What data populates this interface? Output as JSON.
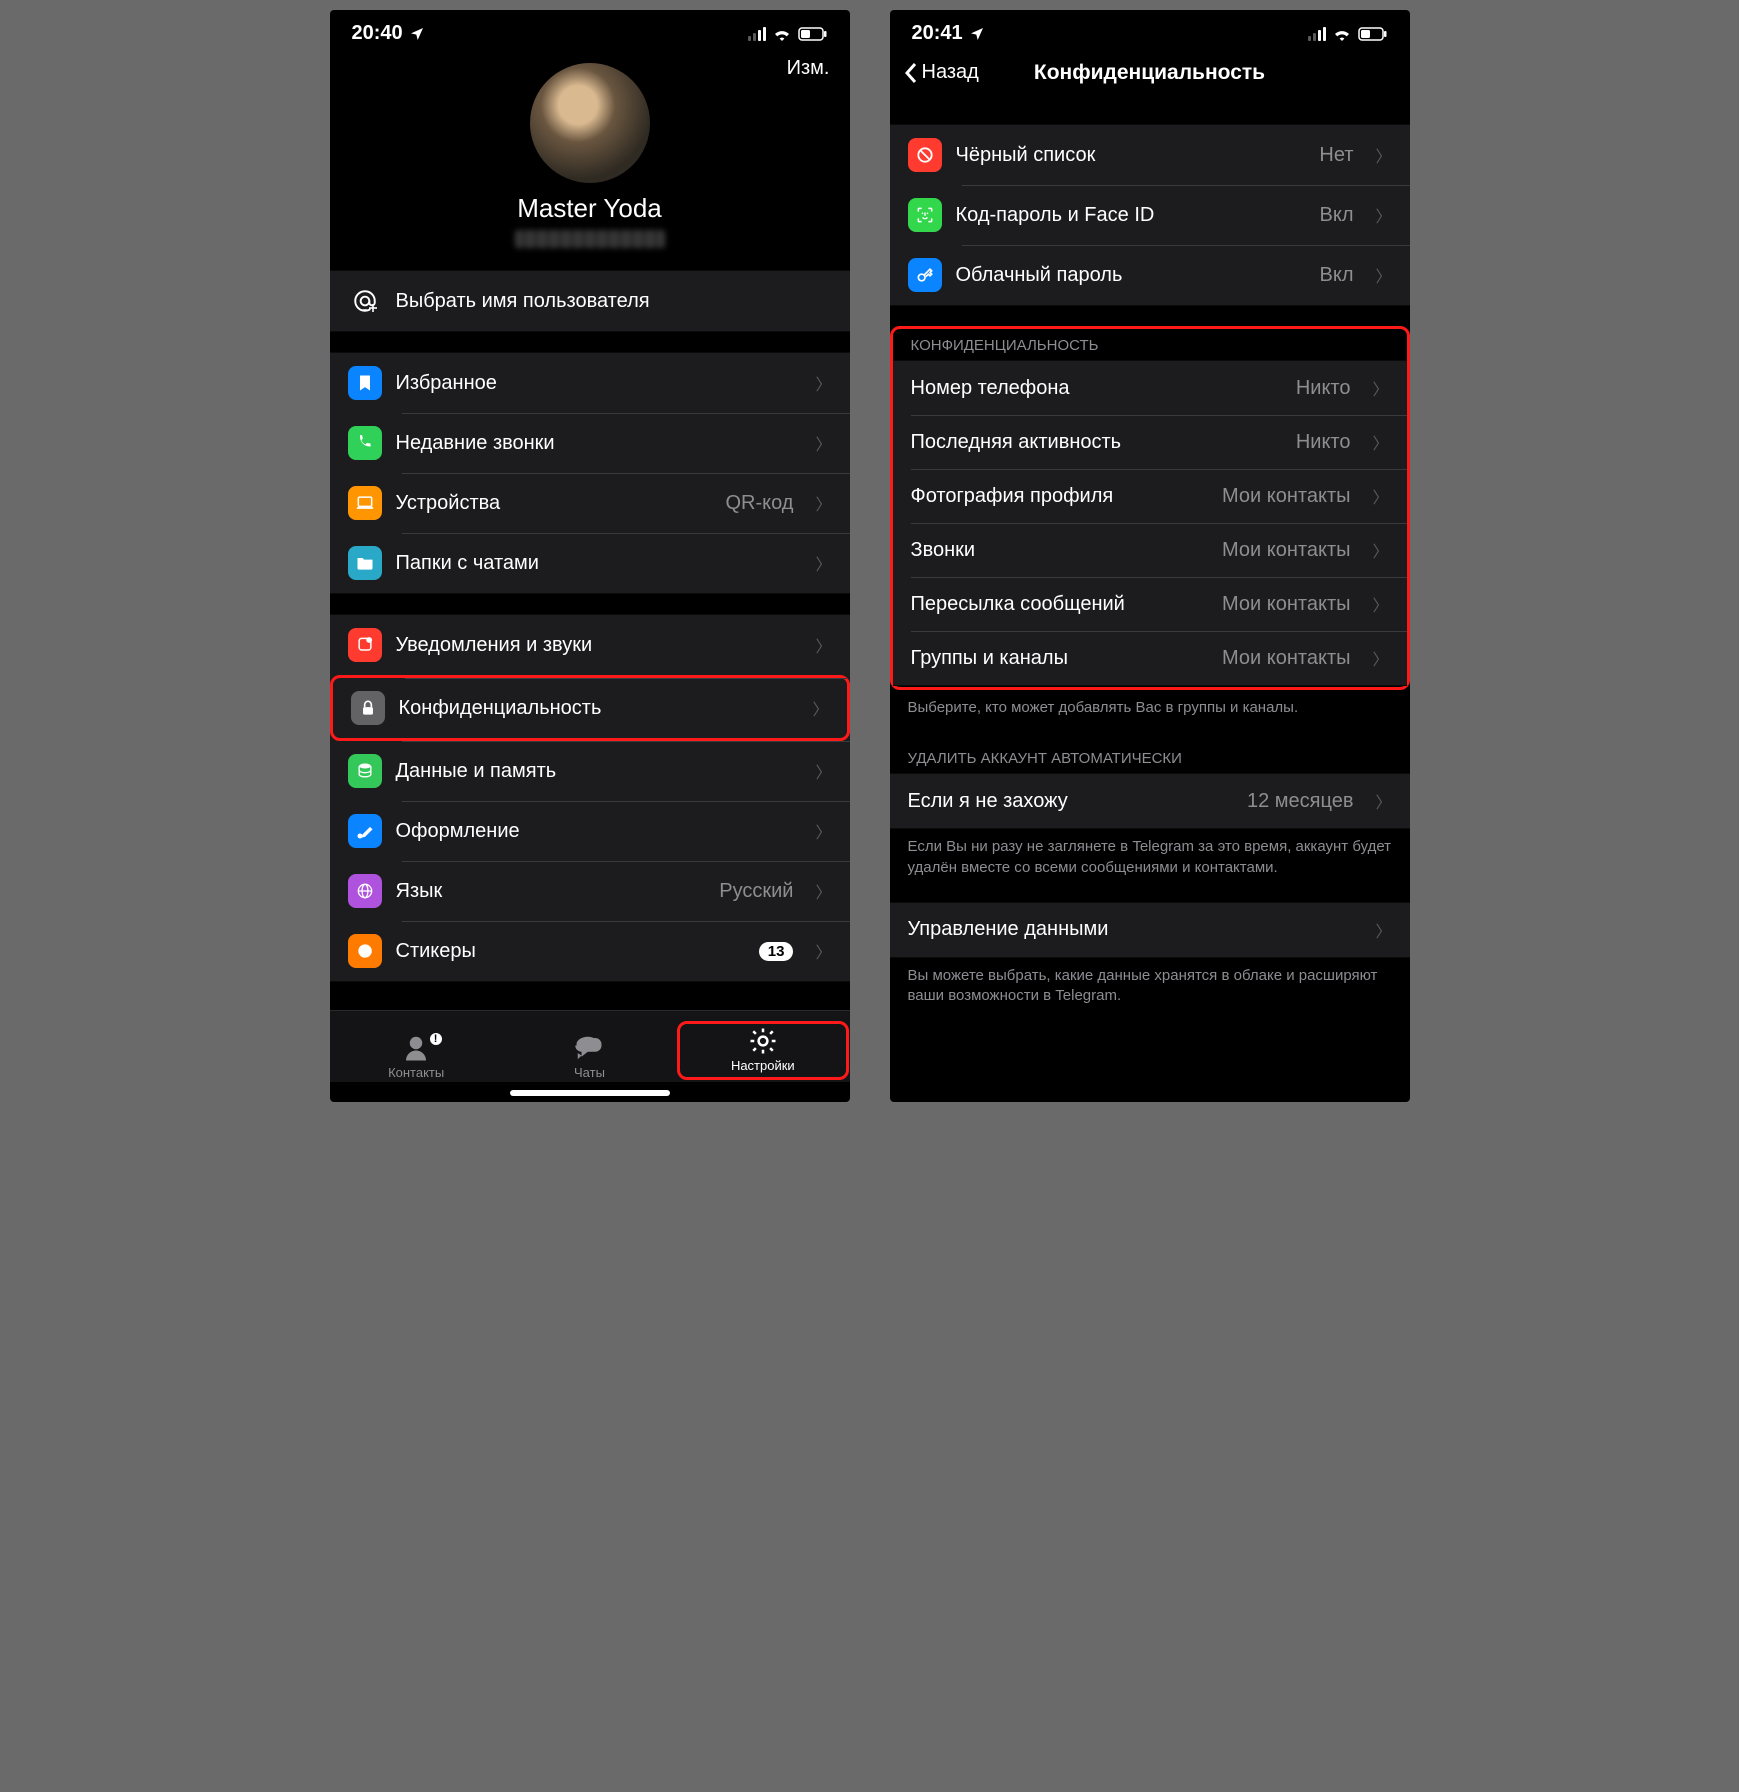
{
  "left": {
    "status_time": "20:40",
    "edit": "Изм.",
    "profile_name": "Master Yoda",
    "username_row": "Выбрать имя пользователя",
    "group1": [
      {
        "id": "favorites",
        "label": "Избранное",
        "value": "",
        "icon": "bookmark",
        "color": "bluebox"
      },
      {
        "id": "recent-calls",
        "label": "Недавние звонки",
        "value": "",
        "icon": "phone",
        "color": "greenbox"
      },
      {
        "id": "devices",
        "label": "Устройства",
        "value": "QR-код",
        "icon": "laptop",
        "color": "orangebox"
      },
      {
        "id": "folders",
        "label": "Папки с чатами",
        "value": "",
        "icon": "folder",
        "color": "tealbox"
      }
    ],
    "group2": [
      {
        "id": "notifications",
        "label": "Уведомления и звуки",
        "value": "",
        "icon": "bell",
        "color": "redbox"
      },
      {
        "id": "privacy",
        "label": "Конфиденциальность",
        "value": "",
        "icon": "lock",
        "color": "graybox",
        "highlight": true
      },
      {
        "id": "data",
        "label": "Данные и память",
        "value": "",
        "icon": "stack",
        "color": "lt-greenbox"
      },
      {
        "id": "appearance",
        "label": "Оформление",
        "value": "",
        "icon": "brush",
        "color": "bluebox"
      },
      {
        "id": "language",
        "label": "Язык",
        "value": "Русский",
        "icon": "globe",
        "color": "purplebox"
      },
      {
        "id": "stickers",
        "label": "Стикеры",
        "value": "",
        "badge": "13",
        "icon": "pacman",
        "color": "dkorange"
      }
    ],
    "tabs": {
      "contacts": "Контакты",
      "chats": "Чаты",
      "settings": "Настройки"
    }
  },
  "right": {
    "status_time": "20:41",
    "back": "Назад",
    "title": "Конфиденциальность",
    "sec_group": [
      {
        "id": "blacklist",
        "label": "Чёрный список",
        "value": "Нет",
        "icon": "slash",
        "color": "redbox"
      },
      {
        "id": "passcode",
        "label": "Код-пароль и Face ID",
        "value": "Вкл",
        "icon": "faceid",
        "color": "facebox"
      },
      {
        "id": "cloudpw",
        "label": "Облачный пароль",
        "value": "Вкл",
        "icon": "key",
        "color": "keybox"
      }
    ],
    "privacy_header": "Конфиденциальность",
    "privacy_rows": [
      {
        "id": "phone",
        "label": "Номер телефона",
        "value": "Никто"
      },
      {
        "id": "lastseen",
        "label": "Последняя активность",
        "value": "Никто"
      },
      {
        "id": "photo",
        "label": "Фотография профиля",
        "value": "Мои контакты"
      },
      {
        "id": "calls",
        "label": "Звонки",
        "value": "Мои контакты"
      },
      {
        "id": "forwarding",
        "label": "Пересылка сообщений",
        "value": "Мои контакты"
      },
      {
        "id": "groups",
        "label": "Группы и каналы",
        "value": "Мои контакты"
      }
    ],
    "privacy_footer": "Выберите, кто может добавлять Вас в группы и каналы.",
    "delete_header": "Удалить аккаунт автоматически",
    "delete_row": {
      "label": "Если я не захожу",
      "value": "12 месяцев"
    },
    "delete_footer": "Если Вы ни разу не заглянете в Telegram за это время, аккаунт будет удалён вместе со всеми сообщениями и контактами.",
    "data_row": "Управление данными",
    "data_footer": "Вы можете выбрать, какие данные хранятся в облаке и расширяют ваши возможности в Telegram."
  }
}
